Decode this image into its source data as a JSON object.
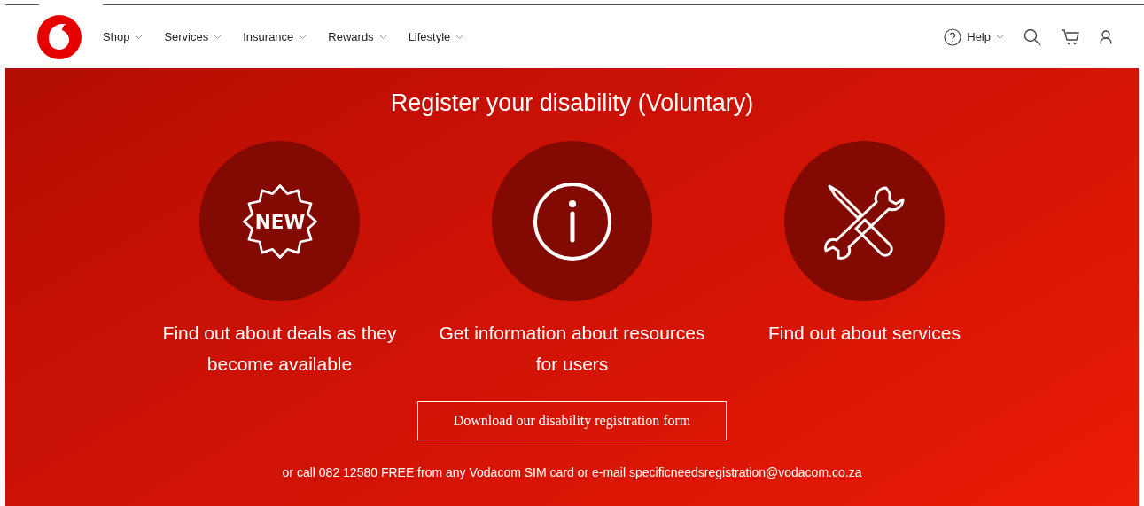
{
  "header": {
    "nav": [
      {
        "label": "Shop"
      },
      {
        "label": "Services"
      },
      {
        "label": "Insurance"
      },
      {
        "label": "Rewards"
      },
      {
        "label": "Lifestyle"
      }
    ],
    "help": {
      "label": "Help"
    }
  },
  "hero": {
    "title": "Register your disability (Voluntary)",
    "features": [
      {
        "kind": "new",
        "badge_text": "NEW",
        "caption": "Find out about deals as they become available"
      },
      {
        "kind": "info",
        "caption": "Get information about resources for users"
      },
      {
        "kind": "tools",
        "caption": "Find out about services"
      }
    ],
    "button": "Download our disability registration form",
    "footnote": "or call 082 12580 FREE from any Vodacom SIM card or e-mail specificneedsregistration@vodacom.co.za"
  }
}
